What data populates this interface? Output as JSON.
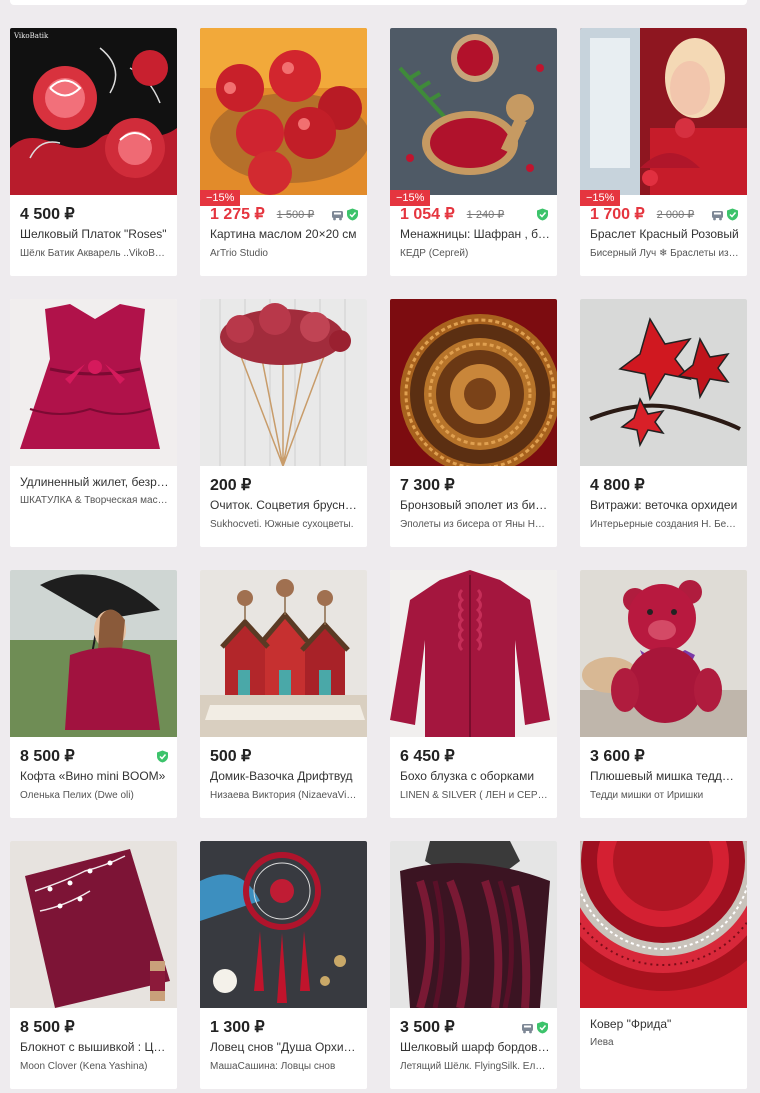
{
  "colors": {
    "sale": "#e5353f",
    "verified": "#3cc36b",
    "delivery_icon": "#7d8795"
  },
  "cards": [
    {
      "price": "4 500 ₽",
      "sale": false,
      "title": "Шелковый Платок \"Roses\"",
      "seller": "Шёлк Батик Акварель ..VikoBatik",
      "verified": false,
      "delivery": false
    },
    {
      "price": "1 275 ₽",
      "old_price": "1 500 ₽",
      "discount": "−15%",
      "sale": true,
      "title": "Картина маслом 20×20 см",
      "seller": "ArTrio Studio",
      "verified": true,
      "delivery": true
    },
    {
      "price": "1 054 ₽",
      "old_price": "1 240 ₽",
      "discount": "−15%",
      "sale": true,
      "title": "Менажницы: Шафран , береза",
      "seller": "КЕДР (Сергей)",
      "verified": true,
      "delivery": false
    },
    {
      "price": "1 700 ₽",
      "old_price": "2 000 ₽",
      "discount": "−15%",
      "sale": true,
      "title": "Браслет Красный Розовый",
      "seller": "Бисерный Луч ❄ Браслеты из бисера",
      "verified": true,
      "delivery": true
    },
    {
      "price": "",
      "sale": false,
      "title": "Удлиненный жилет, безрукавка",
      "seller": "ШКАТУЛКА & Творческая мастерская",
      "verified": false,
      "delivery": false,
      "no_price": true
    },
    {
      "price": "200 ₽",
      "sale": false,
      "title": "Очиток. Соцветия брусники",
      "seller": "Sukhocveti. Южные сухоцветы.",
      "verified": false,
      "delivery": false
    },
    {
      "price": "7 300 ₽",
      "sale": false,
      "title": "Бронзовый эполет из бисера",
      "seller": "Эполеты из бисера от Яны Ноябрь",
      "verified": false,
      "delivery": false
    },
    {
      "price": "4 800 ₽",
      "sale": false,
      "title": "Витражи: веточка орхидеи",
      "seller": "Интерьерные создания Н. Беловой",
      "verified": false,
      "delivery": false
    },
    {
      "price": "8 500 ₽",
      "sale": false,
      "title": "Кофта «Вино mini BOOM»",
      "seller": "Оленька Пелих (Dwe oli)",
      "verified": true,
      "delivery": false
    },
    {
      "price": "500 ₽",
      "sale": false,
      "title": "Домик-Вазочка Дрифтвуд",
      "seller": "Низаева Виктория (NizaevaViktoria)",
      "verified": false,
      "delivery": false
    },
    {
      "price": "6 450 ₽",
      "sale": false,
      "title": "Бохо блузка с оборками",
      "seller": "LINEN & SILVER ( ЛЕН и СЕРЕБРО )",
      "verified": false,
      "delivery": false
    },
    {
      "price": "3 600 ₽",
      "sale": false,
      "title": "Плюшевый мишка тедди Вишня",
      "seller": "Тедди мишки от Иришки",
      "verified": false,
      "delivery": false
    },
    {
      "price": "8 500 ₽",
      "sale": false,
      "title": "Блокнот с вышивкой : Цветы",
      "seller": "Moon Clover (Kena Yashina)",
      "verified": false,
      "delivery": false
    },
    {
      "price": "1 300 ₽",
      "sale": false,
      "title": "Ловец снов \"Душа Орхидеи\"",
      "seller": "МашаСашина: Ловцы снов",
      "verified": false,
      "delivery": false
    },
    {
      "price": "3 500 ₽",
      "sale": false,
      "title": "Шелковый шарф бордовый",
      "seller": "Летящий Шёлк. FlyingSilk. Елена",
      "verified": true,
      "delivery": true
    },
    {
      "price": "",
      "sale": false,
      "title": "Ковер \"Фрида\"",
      "seller": "Иева",
      "verified": false,
      "delivery": false,
      "no_price": true
    }
  ],
  "watermark": "VikoBatik"
}
